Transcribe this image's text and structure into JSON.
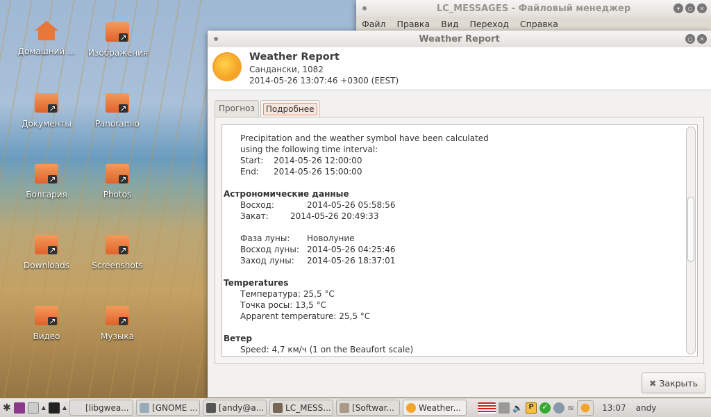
{
  "desktop": {
    "icons": [
      "Домашний ...",
      "Изображения",
      "Документы",
      "Panoramio",
      "Болгария",
      "Photos",
      "Downloads",
      "Screenshots",
      "Видео",
      "Музыка"
    ]
  },
  "file_manager": {
    "title": "LC_MESSAGES - Файловый менеджер",
    "menu": [
      "Файл",
      "Правка",
      "Вид",
      "Переход",
      "Справка"
    ]
  },
  "weather": {
    "window_title": "Weather Report",
    "title": "Weather Report",
    "location": "Сандански, 1082",
    "time": "2014-05-26 13:07:46 +0300 (EEST)",
    "tabs": [
      "Прогноз",
      "Подробнее"
    ],
    "intro": [
      "Precipitation and the weather symbol have been calculated",
      "using the following time interval:"
    ],
    "start_label": "Start:",
    "start": "2014-05-26 12:00:00",
    "end_label": "End:",
    "end": "2014-05-26 15:00:00",
    "astro_heading": "Астрономические данные",
    "sunrise_label": "Восход:",
    "sunrise": "2014-05-26 05:58:56",
    "sunset_label": "Закат:",
    "sunset": "2014-05-26 20:49:33",
    "moon_phase_label": "Фаза луны:",
    "moon_phase": "Новолуние",
    "moonrise_label": "Восход луны:",
    "moonrise": "2014-05-26 04:25:46",
    "moonset_label": "Заход луны:",
    "moonset": "2014-05-26 18:37:01",
    "temp_heading": "Temperatures",
    "temperature": "Температура: 25,5 °C",
    "dewpoint": "Точка росы: 13,5 °C",
    "apparent": "Apparent temperature: 25,5 °C",
    "wind_heading": "Ветер",
    "wind_speed": "Speed: 4,7 км/ч (1 on the Beaufort scale)",
    "close_label": "Закрыть"
  },
  "taskbar": {
    "tasks": [
      "[libgwea...",
      "[GNOME ...",
      "[andy@a...",
      "LC_MESS...",
      "[Softwar...",
      "Weather..."
    ],
    "clock": "13:07",
    "user": "andy"
  }
}
